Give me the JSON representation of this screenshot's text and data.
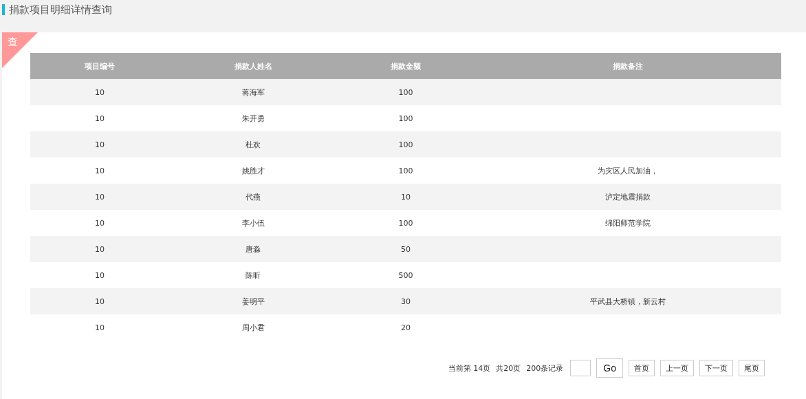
{
  "page_title": "捐款项目明细详情查询",
  "corner_badge": "查",
  "table": {
    "columns": [
      "项目编号",
      "捐款人姓名",
      "捐款金额",
      "捐款备注"
    ],
    "rows": [
      [
        "10",
        "蒋海军",
        "100",
        ""
      ],
      [
        "10",
        "朱开勇",
        "100",
        ""
      ],
      [
        "10",
        "杜欢",
        "100",
        ""
      ],
      [
        "10",
        "姚胜才",
        "100",
        "为灾区人民加油，"
      ],
      [
        "10",
        "代燕",
        "10",
        "泸定地震捐款"
      ],
      [
        "10",
        "李小伍",
        "100",
        "绵阳师范学院"
      ],
      [
        "10",
        "唐淼",
        "50",
        ""
      ],
      [
        "10",
        "陈昕",
        "500",
        ""
      ],
      [
        "10",
        "姜明平",
        "30",
        "平武县大桥镇，新云村"
      ],
      [
        "10",
        "周小君",
        "20",
        ""
      ]
    ]
  },
  "pagination": {
    "current": "当前第  14页",
    "total_pages": "共20页",
    "records": "200条记录",
    "go": "Go",
    "buttons": [
      "首页",
      "上一页",
      "下一页",
      "尾页"
    ]
  }
}
